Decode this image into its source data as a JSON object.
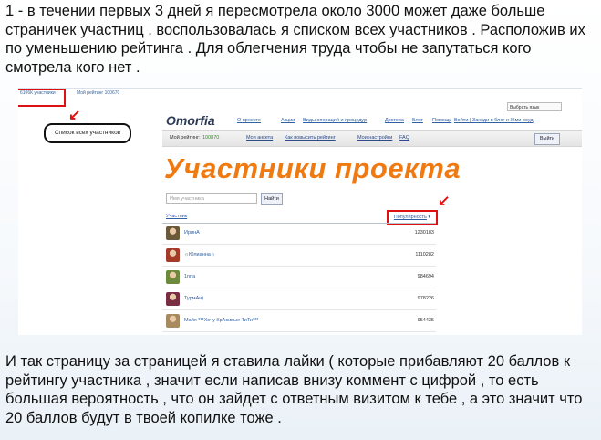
{
  "caption_top": "1 - в течении первых 3 дней я пересмотрела около 3000 может даже больше страничек участниц . воспользовалась  я списком всех участников . Расположив их по уменьшению рейтинга . Для облегчения труда чтобы не запутаться кого смотрела кого нет   .",
  "caption_bottom": "И так страницу за страницей я ставила лайки ( которые прибавляют 20 баллов к рейтингу участника , значит если написав внизу коммент с цифрой , то есть большая вероятность , что он зайдет с ответным визитом к тебе  , а это значит что 20 баллов будут в твоей копилке тоже .",
  "screenshot": {
    "top_strip": {
      "left_link": "6106К участники",
      "right_link": "Мой рейтинг 100670"
    },
    "callout_label": "Список всех участников",
    "logo": "Omorfia",
    "language_selector": "Выбрать язык",
    "top_nav": [
      "О проекте",
      "Акции",
      "Виды операций и процедур",
      "Доктора",
      "Блог",
      "Помощь",
      "Войти | Заходи в блог и Жми осуд"
    ],
    "rating": {
      "label": "Мой рейтинг:",
      "value": "100870"
    },
    "menu": [
      "Моя анкета",
      "Как повысить рейтинг",
      "Мои настройки",
      "FAQ"
    ],
    "exit_label": "Выйти",
    "hero_title": "Участники проекта",
    "search": {
      "placeholder": "Имя участника",
      "button": "Найти"
    },
    "list_header": {
      "left": "Участник",
      "sort": "Популярность"
    },
    "arrow_glyph": "↙",
    "rows": [
      {
        "name": "ИринА",
        "score": "1230183",
        "avatar": "#6b5a3a"
      },
      {
        "name": "☼Юлианна☼",
        "score": "1110282",
        "avatar": "#a53a2a"
      },
      {
        "name": "1nna",
        "score": "984694",
        "avatar": "#6d8a3c"
      },
      {
        "name": "ТурмАн)",
        "score": "978226",
        "avatar": "#7a2e44"
      },
      {
        "name": "Майя ***Хочу КрАсивые ТиТи***",
        "score": "954435",
        "avatar": "#a88a60"
      }
    ]
  }
}
